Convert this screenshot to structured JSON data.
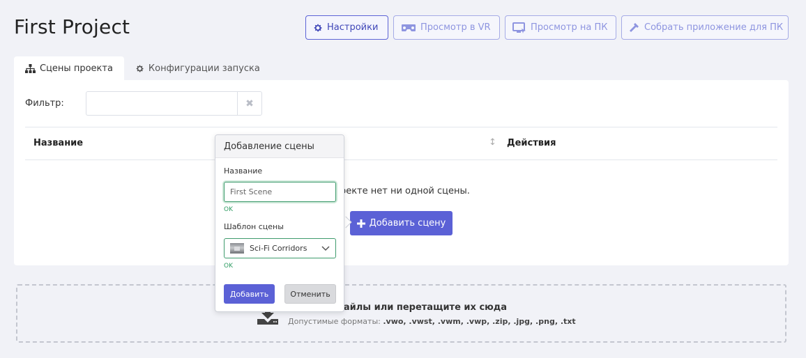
{
  "title": "First Project",
  "toolbar": {
    "settings": "Настройки",
    "view_vr": "Просмотр в VR",
    "view_pc": "Просмотр на ПК",
    "build_pc": "Собрать приложение для ПК"
  },
  "tabs": {
    "scenes": "Сцены проекта",
    "launch_configs": "Конфигурации запуска"
  },
  "filter": {
    "label": "Фильтр:",
    "value": "",
    "clear_icon": "✖"
  },
  "table": {
    "col_name": "Название",
    "col_actions": "Действия",
    "empty_text": "роекте нет ни одной сцены.",
    "add_scene": "Добавить сцену"
  },
  "dropzone": {
    "title": "файлы или перетащите их сюда",
    "formats_prefix": "Допустимые форматы:",
    "formats": ".vwo, .vwst, .vwm, .vwp, .zip, .jpg, .png, .txt"
  },
  "popover": {
    "title": "Добавление сцены",
    "name_label": "Название",
    "name_value": "First Scene",
    "name_status": "OK",
    "template_label": "Шаблон сцены",
    "template_value": "Sci-Fi Corridors",
    "template_status": "OK",
    "add_button": "Добавить",
    "cancel_button": "Отменить"
  },
  "colors": {
    "accent": "#5b61d6",
    "ok": "#2f9c63",
    "background": "#f1f2f7"
  }
}
